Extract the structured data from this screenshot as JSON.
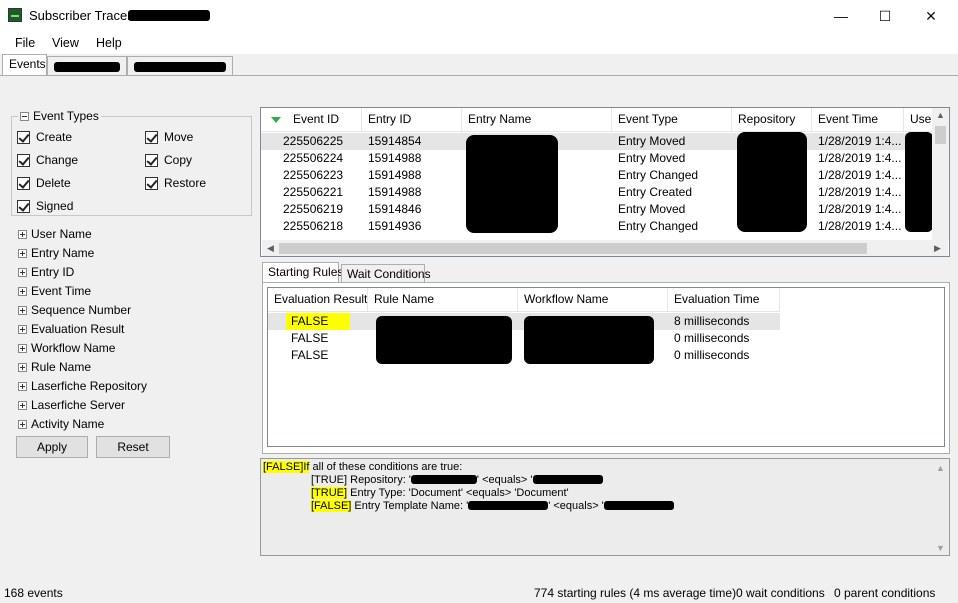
{
  "window": {
    "title": "Subscriber Tracer - ",
    "minimize": "—",
    "maximize": "☐",
    "close": "✕"
  },
  "menu": [
    "File",
    "View",
    "Help"
  ],
  "top_tabs": [
    "Events"
  ],
  "event_types": {
    "legend": "Event Types",
    "items": [
      {
        "label": "Create",
        "checked": true
      },
      {
        "label": "Move",
        "checked": true
      },
      {
        "label": "Change",
        "checked": true
      },
      {
        "label": "Copy",
        "checked": true
      },
      {
        "label": "Delete",
        "checked": true
      },
      {
        "label": "Restore",
        "checked": true
      },
      {
        "label": "Signed",
        "checked": true
      }
    ]
  },
  "filters": [
    "User Name",
    "Entry Name",
    "Entry ID",
    "Event Time",
    "Sequence Number",
    "Evaluation Result",
    "Workflow Name",
    "Rule Name",
    "Laserfiche Repository",
    "Laserfiche Server",
    "Activity Name"
  ],
  "buttons": {
    "apply": "Apply",
    "reset": "Reset"
  },
  "events_table": {
    "columns": [
      "Event ID",
      "Entry ID",
      "Entry Name",
      "Event Type",
      "Repository",
      "Event Time",
      "User"
    ],
    "rows": [
      {
        "event_id": "225506225",
        "entry_id": "15914854",
        "entry_name": "",
        "event_type": "Entry Moved",
        "repository": "",
        "event_time": "1/28/2019 1:4...",
        "user": ""
      },
      {
        "event_id": "225506224",
        "entry_id": "15914988",
        "entry_name": "",
        "event_type": "Entry Moved",
        "repository": "",
        "event_time": "1/28/2019 1:4...",
        "user": ""
      },
      {
        "event_id": "225506223",
        "entry_id": "15914988",
        "entry_name": "",
        "event_type": "Entry Changed",
        "repository": "",
        "event_time": "1/28/2019 1:4...",
        "user": ""
      },
      {
        "event_id": "225506221",
        "entry_id": "15914988",
        "entry_name": "",
        "event_type": "Entry Created",
        "repository": "",
        "event_time": "1/28/2019 1:4...",
        "user": ""
      },
      {
        "event_id": "225506219",
        "entry_id": "15914846",
        "entry_name": "",
        "event_type": "Entry Moved",
        "repository": "",
        "event_time": "1/28/2019 1:4...",
        "user": ""
      },
      {
        "event_id": "225506218",
        "entry_id": "15914936",
        "entry_name": "",
        "event_type": "Entry Changed",
        "repository": "",
        "event_time": "1/28/2019 1:4...",
        "user": ""
      }
    ]
  },
  "rule_tabs": [
    "Starting Rules",
    "Wait Conditions"
  ],
  "rules_table": {
    "columns": [
      "Evaluation Result",
      "Rule Name",
      "Workflow Name",
      "Evaluation Time"
    ],
    "rows": [
      {
        "result": "FALSE",
        "rule_name": "",
        "workflow_name": "",
        "time": "8 milliseconds",
        "highlighted": true
      },
      {
        "result": "FALSE",
        "rule_name": "",
        "workflow_name": "",
        "time": "0 milliseconds",
        "highlighted": false
      },
      {
        "result": "FALSE",
        "rule_name": "",
        "workflow_name": "",
        "time": "0 milliseconds",
        "highlighted": false
      }
    ]
  },
  "details": {
    "line1_result": "[FALSE]",
    "line1_if": "If",
    "line1_text": " all of these conditions are true:",
    "line2_tag": "[TRUE]",
    "line2_text": " Repository: '",
    "line2_equals": "' <equals> '",
    "line3_tag": "[TRUE]",
    "line3_text": " Entry Type: 'Document' <equals> 'Document'",
    "line4_tag": "[FALSE]",
    "line4_text": " Entry Template Name: '",
    "line4_equals": "' <equals> '"
  },
  "status": {
    "events": "168 events",
    "starting_rules": "774 starting rules (4 ms average time)",
    "wait_conditions": "0 wait conditions",
    "parent_conditions": "0 parent conditions"
  },
  "colors": {
    "highlight": "#ffff00",
    "sort_arrow": "#3aa84a",
    "redaction": "#000000"
  }
}
